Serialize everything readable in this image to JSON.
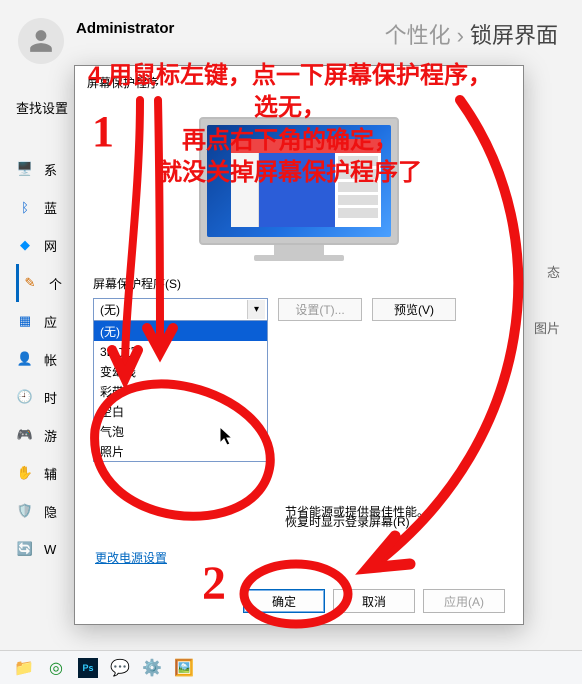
{
  "header": {
    "user": "Administrator",
    "crumb1": "个性化",
    "crumb2": "锁屏界面"
  },
  "sidebar": {
    "search": "查找设置",
    "items": [
      {
        "icon": "monitor",
        "label": "系",
        "rt": ""
      },
      {
        "icon": "bluetooth",
        "label": "蓝",
        "rt": ""
      },
      {
        "icon": "wifi",
        "label": "网",
        "rt": ""
      },
      {
        "icon": "person",
        "label": "个",
        "rt": "态"
      },
      {
        "icon": "apps",
        "label": "应",
        "rt": "图片"
      },
      {
        "icon": "account",
        "label": "帐",
        "rt": ""
      },
      {
        "icon": "time",
        "label": "时",
        "rt": ""
      },
      {
        "icon": "game",
        "label": "游",
        "rt": ""
      },
      {
        "icon": "access",
        "label": "辅",
        "rt": ""
      },
      {
        "icon": "privacy",
        "label": "隐",
        "rt": ""
      },
      {
        "icon": "update",
        "label": "W",
        "rt": ""
      }
    ]
  },
  "right": {
    "status": "态",
    "pic": "图片"
  },
  "dialog": {
    "title": "屏幕保护程序",
    "group_label": "屏幕保护程序(S)",
    "combo": {
      "selected": "(无)",
      "options": [
        "(无)",
        "3D 文字",
        "变幻线",
        "彩带",
        "空白",
        "气泡",
        "照片"
      ],
      "selected_index": 0
    },
    "btn_settings": "设置(T)...",
    "btn_preview": "预览(V)",
    "resume_label": "恢复时显示登录屏幕(R)",
    "power_hint": "节省能源或提供最佳性能。",
    "power_link": "更改电源设置",
    "btn_ok": "确定",
    "btn_cancel": "取消",
    "btn_apply": "应用(A)"
  },
  "annotation": {
    "step": "4.",
    "line1": "用鼠标左键，点一下屏幕保护程序，",
    "line2": "选无，",
    "line3": "再点右下角的确定，",
    "line4": "就没关掉屏幕保护程序了",
    "num1": "1",
    "num2": "2"
  }
}
